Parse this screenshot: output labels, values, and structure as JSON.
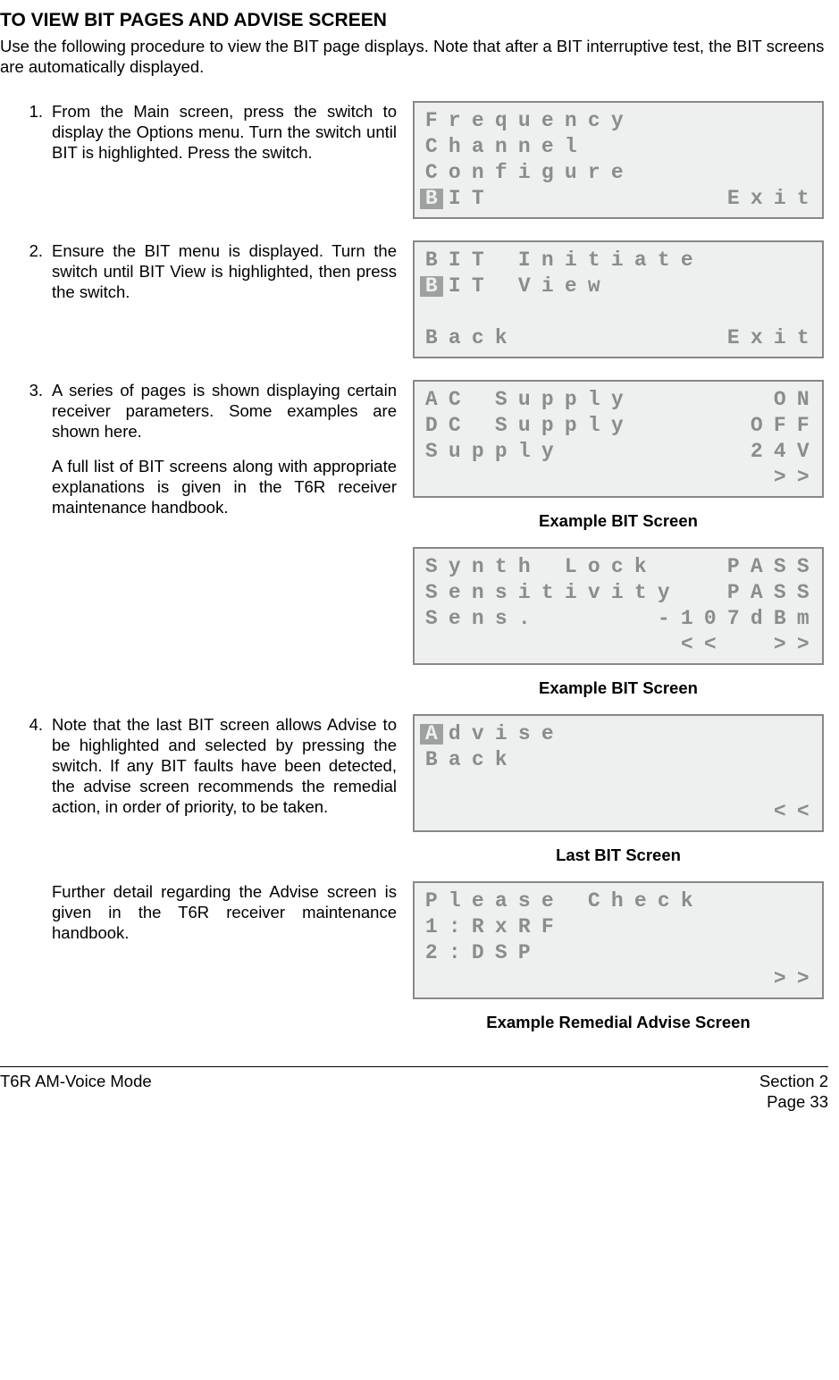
{
  "heading": "TO VIEW BIT PAGES AND ADVISE SCREEN",
  "intro": "Use the following procedure to view the BIT page displays. Note that after a BIT interruptive test, the BIT screens are automatically displayed.",
  "steps": {
    "s1": {
      "num": "1.",
      "text": "From the Main screen, press the switch to display the Options menu. Turn the switch until BIT is highlighted. Press the switch."
    },
    "s2": {
      "num": "2.",
      "text": "Ensure the BIT menu is displayed. Turn the switch until BIT View is highlighted, then press the switch."
    },
    "s3": {
      "num": "3.",
      "text_a": "A series of pages is shown displaying certain receiver parameters. Some examples are shown here.",
      "text_b": "A full list of BIT screens along with appropriate explanations is given in the T6R receiver maintenance handbook."
    },
    "s4": {
      "num": "4.",
      "text_a": "Note that the last BIT screen allows Advise to be highlighted and selected by pressing the switch. If any BIT faults have been detected, the advise screen recommends the remedial action, in order of priority, to be taken.",
      "text_b": "Further detail regarding the Advise screen is given in the T6R receiver maintenance handbook."
    }
  },
  "captions": {
    "example_bit": "Example BIT Screen",
    "last_bit": "Last BIT Screen",
    "remedial": "Example Remedial Advise Screen"
  },
  "lcd1": {
    "r1": [
      "F",
      "r",
      "e",
      "q",
      "u",
      "e",
      "n",
      "c",
      "y",
      "",
      "",
      "",
      "",
      "",
      "",
      "",
      ""
    ],
    "r2": [
      "C",
      "h",
      "a",
      "n",
      "n",
      "e",
      "l",
      "",
      "",
      "",
      "",
      "",
      "",
      "",
      "",
      "",
      ""
    ],
    "r3": [
      "C",
      "o",
      "n",
      "f",
      "i",
      "g",
      "u",
      "r",
      "e",
      "",
      "",
      "",
      "",
      "",
      "",
      "",
      ""
    ],
    "r4": [
      "B",
      "I",
      "T",
      "",
      "",
      "",
      "",
      "",
      "",
      "",
      "",
      "",
      "",
      "E",
      "x",
      "i",
      "t"
    ],
    "hi": [
      [
        3,
        0
      ]
    ]
  },
  "lcd2": {
    "r1": [
      "B",
      "I",
      "T",
      "",
      "I",
      "n",
      "i",
      "t",
      "i",
      "a",
      "t",
      "e",
      "",
      "",
      "",
      "",
      ""
    ],
    "r2": [
      "B",
      "I",
      "T",
      "",
      "V",
      "i",
      "e",
      "w",
      "",
      "",
      "",
      "",
      "",
      "",
      "",
      "",
      ""
    ],
    "r3": [
      "",
      "",
      "",
      "",
      "",
      "",
      "",
      "",
      "",
      "",
      "",
      "",
      "",
      "",
      "",
      "",
      ""
    ],
    "r4": [
      "B",
      "a",
      "c",
      "k",
      "",
      "",
      "",
      "",
      "",
      "",
      "",
      "",
      "",
      "E",
      "x",
      "i",
      "t"
    ],
    "hi": [
      [
        1,
        0
      ]
    ]
  },
  "lcd3": {
    "r1": [
      "A",
      "C",
      "",
      "S",
      "u",
      "p",
      "p",
      "l",
      "y",
      "",
      "",
      "",
      "",
      "",
      "",
      "O",
      "N"
    ],
    "r2": [
      "D",
      "C",
      "",
      "S",
      "u",
      "p",
      "p",
      "l",
      "y",
      "",
      "",
      "",
      "",
      "",
      "O",
      "F",
      "F"
    ],
    "r3": [
      "S",
      "u",
      "p",
      "p",
      "l",
      "y",
      "",
      "",
      "",
      "",
      "",
      "",
      "",
      "",
      "2",
      "4",
      "V"
    ],
    "r4": [
      "",
      "",
      "",
      "",
      "",
      "",
      "",
      "",
      "",
      "",
      "",
      "",
      "",
      "",
      "",
      ">",
      ">"
    ],
    "hi": []
  },
  "lcd4": {
    "r1": [
      "S",
      "y",
      "n",
      "t",
      "h",
      "",
      "L",
      "o",
      "c",
      "k",
      "",
      "",
      "",
      "P",
      "A",
      "S",
      "S"
    ],
    "r2": [
      "S",
      "e",
      "n",
      "s",
      "i",
      "t",
      "i",
      "v",
      "i",
      "t",
      "y",
      "",
      "",
      "P",
      "A",
      "S",
      "S"
    ],
    "r3": [
      "S",
      "e",
      "n",
      "s",
      ".",
      "",
      "",
      "",
      "",
      "",
      "-",
      "1",
      "0",
      "7",
      "d",
      "B",
      "m"
    ],
    "r4": [
      "",
      "",
      "",
      "",
      "",
      "",
      "",
      "",
      "",
      "",
      "",
      "<",
      "<",
      "",
      "",
      ">",
      ">"
    ],
    "hi": []
  },
  "lcd5": {
    "r1": [
      "A",
      "d",
      "v",
      "i",
      "s",
      "e",
      "",
      "",
      "",
      "",
      "",
      "",
      "",
      "",
      "",
      "",
      ""
    ],
    "r2": [
      "B",
      "a",
      "c",
      "k",
      "",
      "",
      "",
      "",
      "",
      "",
      "",
      "",
      "",
      "",
      "",
      "",
      ""
    ],
    "r3": [
      "",
      "",
      "",
      "",
      "",
      "",
      "",
      "",
      "",
      "",
      "",
      "",
      "",
      "",
      "",
      "",
      ""
    ],
    "r4": [
      "",
      "",
      "",
      "",
      "",
      "",
      "",
      "",
      "",
      "",
      "",
      "",
      "",
      "",
      "",
      "<",
      "<"
    ],
    "hi": [
      [
        0,
        0
      ]
    ]
  },
  "lcd6": {
    "r1": [
      "P",
      "l",
      "e",
      "a",
      "s",
      "e",
      "",
      "C",
      "h",
      "e",
      "c",
      "k",
      "",
      "",
      "",
      "",
      ""
    ],
    "r2": [
      "1",
      ":",
      "R",
      "x",
      "R",
      "F",
      "",
      "",
      "",
      "",
      "",
      "",
      "",
      "",
      "",
      "",
      ""
    ],
    "r3": [
      "2",
      ":",
      "D",
      "S",
      "P",
      "",
      "",
      "",
      "",
      "",
      "",
      "",
      "",
      "",
      "",
      "",
      ""
    ],
    "r4": [
      "",
      "",
      "",
      "",
      "",
      "",
      "",
      "",
      "",
      "",
      "",
      "",
      "",
      "",
      "",
      ">",
      ">"
    ],
    "hi": []
  },
  "footer": {
    "left": "T6R AM-Voice Mode",
    "right1": "Section 2",
    "right2": "Page 33"
  }
}
